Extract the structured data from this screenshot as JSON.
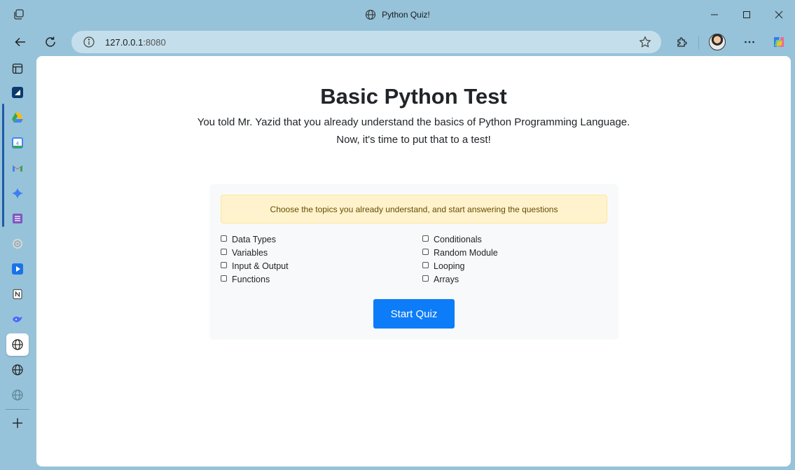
{
  "browser": {
    "tab_title": "Python Quiz!",
    "address": {
      "host": "127.0.0.1",
      "port": ":8080"
    }
  },
  "page": {
    "heading": "Basic Python Test",
    "lead_line1": "You told Mr. Yazid that you already understand the basics of Python Programming Language.",
    "lead_line2": "Now, it's time to put that to a test!",
    "alert": "Choose the topics you already understand, and start answering the questions",
    "topics_left": [
      "Data Types",
      "Variables",
      "Input & Output",
      "Functions"
    ],
    "topics_right": [
      "Conditionals",
      "Random Module",
      "Looping",
      "Arrays"
    ],
    "start_button": "Start Quiz"
  },
  "colors": {
    "chrome_bg": "#96c3d9",
    "primary_button": "#0d7cf8",
    "alert_bg": "#fff3cd",
    "alert_text": "#664d03"
  },
  "icons": {
    "sidebar": [
      "sidebar-toggle-icon",
      "app-icon",
      "google-drive-icon",
      "calendar-icon",
      "gmail-icon",
      "sparkle-icon",
      "forms-icon",
      "circle-app-icon",
      "play-app-icon",
      "notion-icon",
      "deepseek-icon",
      "globe-icon",
      "globe-icon",
      "globe-icon",
      "add-icon"
    ]
  }
}
